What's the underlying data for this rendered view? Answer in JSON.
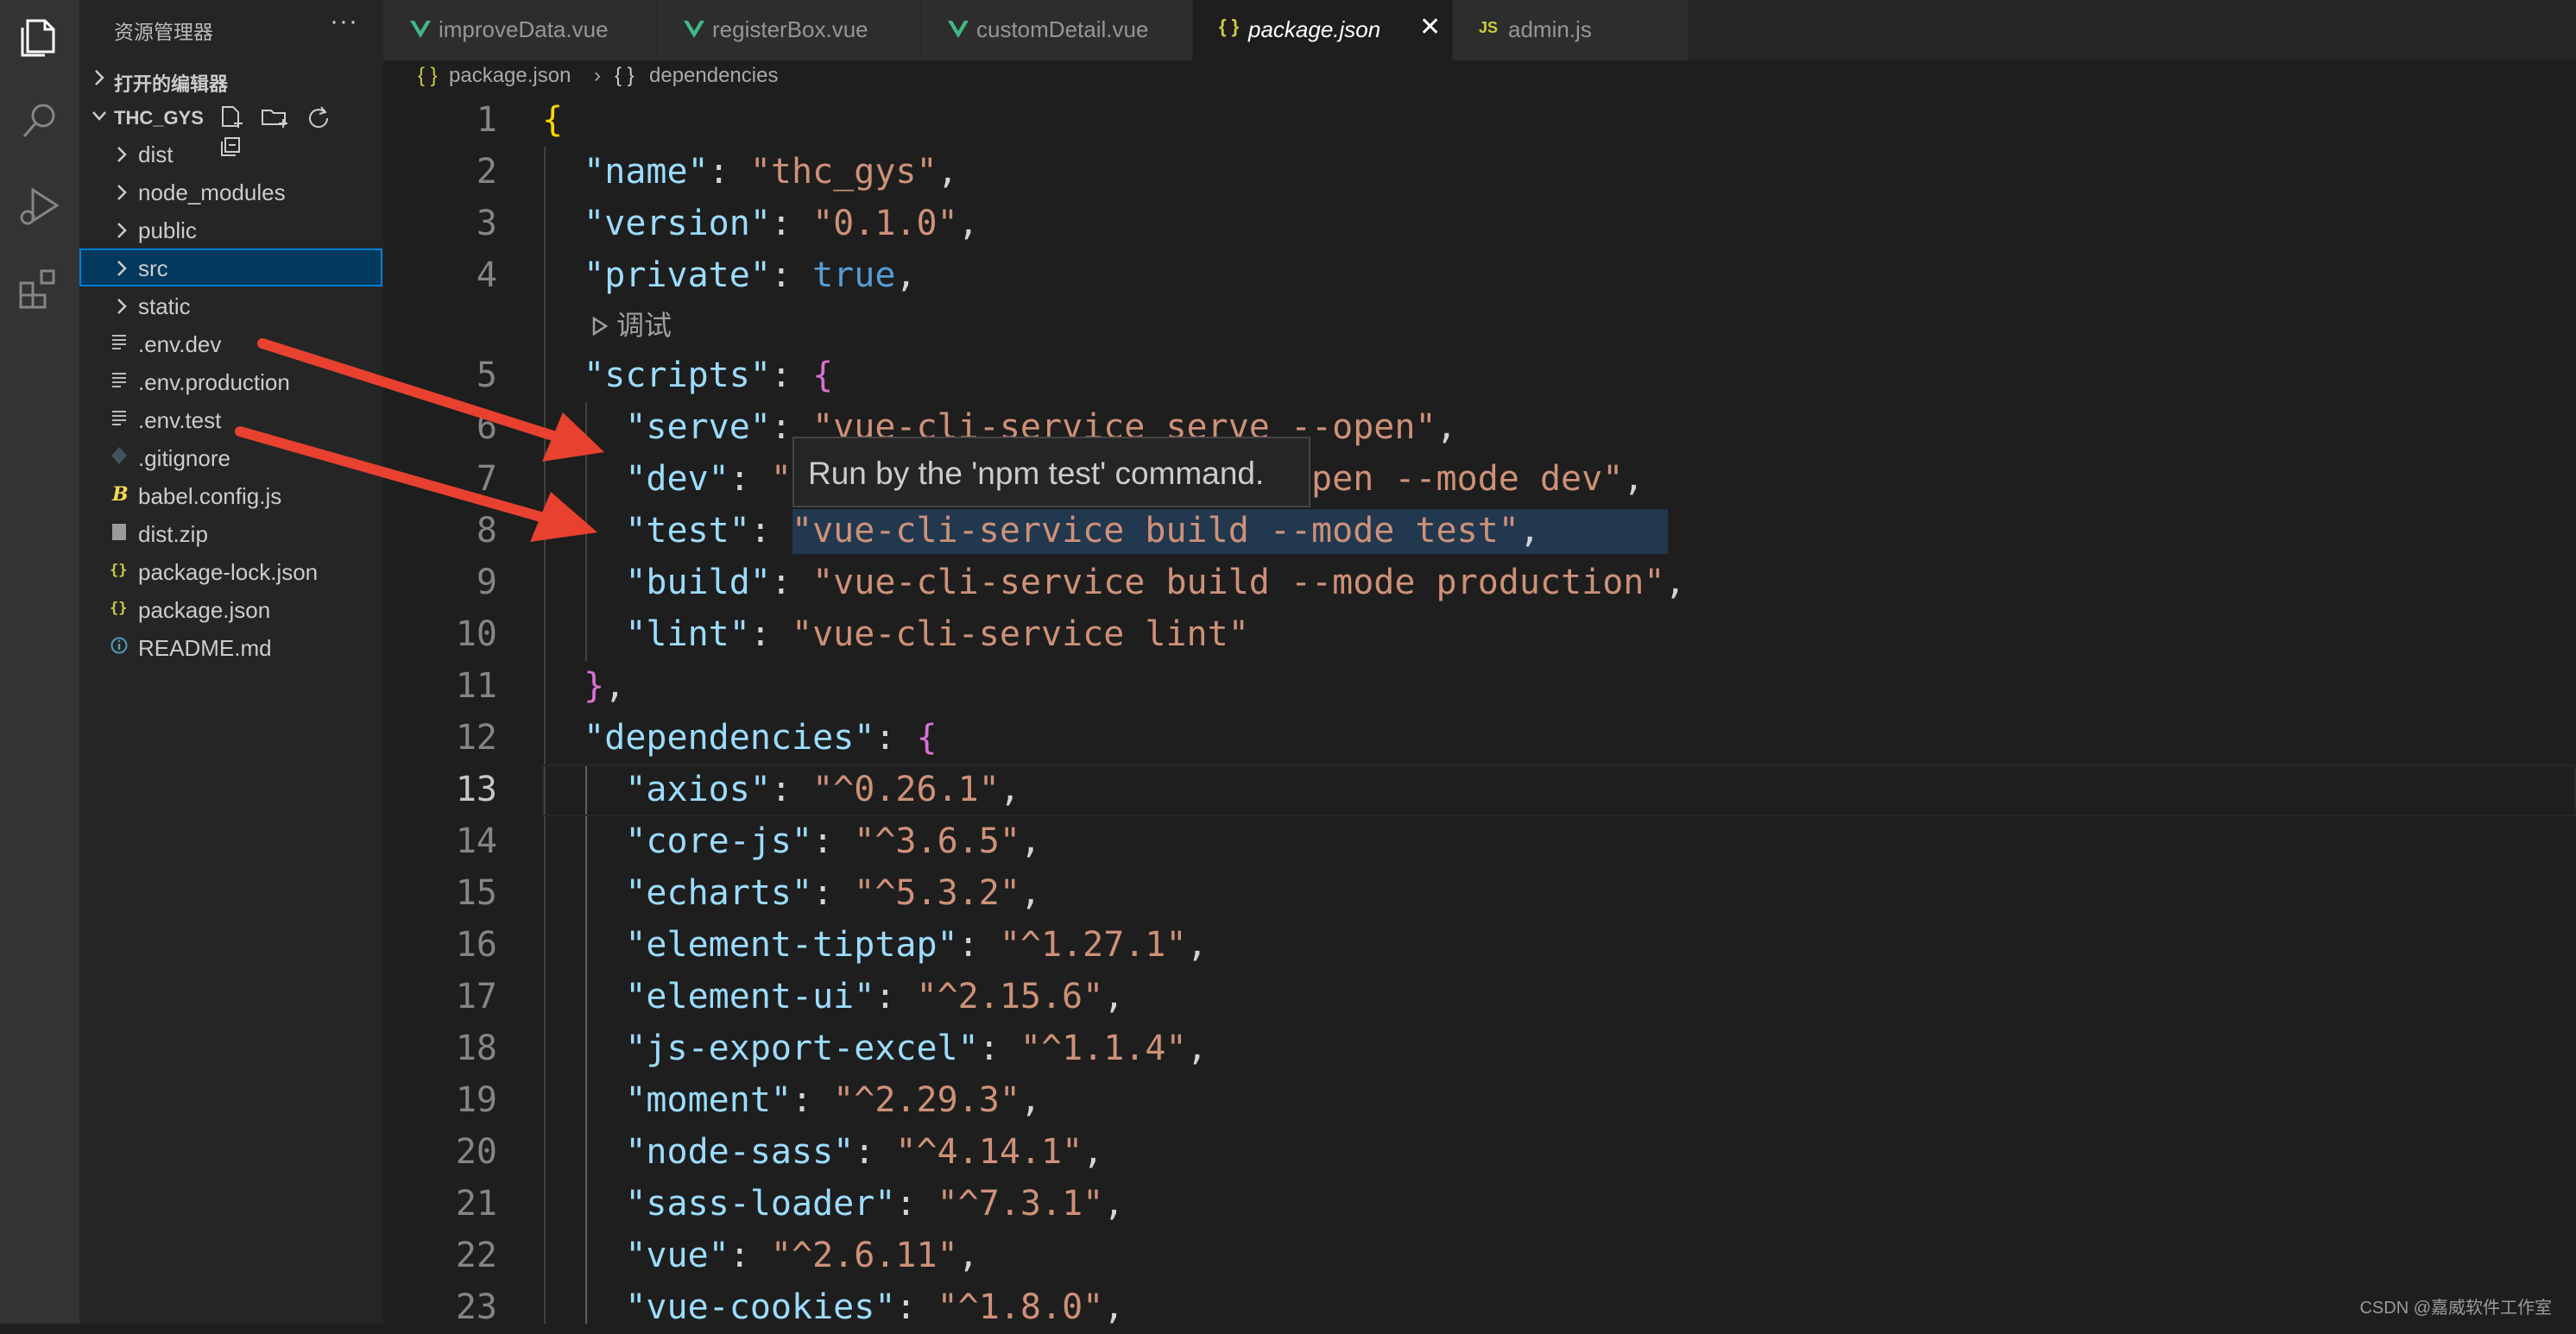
{
  "sidebar": {
    "title": "资源管理器",
    "more": "···",
    "sections": {
      "open_editors": "打开的编辑器",
      "workspace": "THC_GYS"
    },
    "tree": [
      {
        "label": "dist",
        "kind": "folder"
      },
      {
        "label": "node_modules",
        "kind": "folder"
      },
      {
        "label": "public",
        "kind": "folder"
      },
      {
        "label": "src",
        "kind": "folder",
        "selected": true
      },
      {
        "label": "static",
        "kind": "folder"
      },
      {
        "label": ".env.dev",
        "kind": "file-lines"
      },
      {
        "label": ".env.production",
        "kind": "file-lines"
      },
      {
        "label": ".env.test",
        "kind": "file-lines"
      },
      {
        "label": ".gitignore",
        "kind": "git"
      },
      {
        "label": "babel.config.js",
        "kind": "babel"
      },
      {
        "label": "dist.zip",
        "kind": "zip"
      },
      {
        "label": "package-lock.json",
        "kind": "json"
      },
      {
        "label": "package.json",
        "kind": "json"
      },
      {
        "label": "README.md",
        "kind": "info"
      }
    ]
  },
  "tabs": [
    {
      "label": "improveData.vue",
      "icon": "vue-icon"
    },
    {
      "label": "registerBox.vue",
      "icon": "vue-icon"
    },
    {
      "label": "customDetail.vue",
      "icon": "vue-icon"
    },
    {
      "label": "package.json",
      "icon": "json-icon",
      "active": true,
      "close": "✕"
    },
    {
      "label": "admin.js",
      "icon": "js-icon"
    }
  ],
  "tab_icons": {
    "json": "{ }",
    "js": "JS"
  },
  "breadcrumb": {
    "file": "package.json",
    "separator": "›",
    "symbol": "dependencies",
    "icon_text": "{ }"
  },
  "editor": {
    "codelens": "调试",
    "lines": [
      {
        "n": "1"
      },
      {
        "n": "2"
      },
      {
        "n": "3"
      },
      {
        "n": "4"
      },
      {
        "n": "5"
      },
      {
        "n": "6"
      },
      {
        "n": "7"
      },
      {
        "n": "8"
      },
      {
        "n": "9"
      },
      {
        "n": "10"
      },
      {
        "n": "11"
      },
      {
        "n": "12"
      },
      {
        "n": "13"
      },
      {
        "n": "14"
      },
      {
        "n": "15"
      },
      {
        "n": "16"
      },
      {
        "n": "17"
      },
      {
        "n": "18"
      },
      {
        "n": "19"
      },
      {
        "n": "20"
      },
      {
        "n": "21"
      },
      {
        "n": "22"
      },
      {
        "n": "23"
      }
    ],
    "json": {
      "name": "thc_gys",
      "version": "0.1.0",
      "private": "true",
      "scripts": {
        "serve": "vue-cli-service serve --open",
        "dev": "vue-cli-service serve --open --mode dev",
        "test": "vue-cli-service build --mode test",
        "build": "vue-cli-service build --mode production",
        "lint": "vue-cli-service lint"
      },
      "dependencies": {
        "axios": "^0.26.1",
        "core-js": "^3.6.5",
        "echarts": "^5.3.2",
        "element-tiptap": "^1.27.1",
        "element-ui": "^2.15.6",
        "js-export-excel": "^1.1.4",
        "moment": "^2.29.3",
        "node-sass": "^4.14.1",
        "sass-loader": "^7.3.1",
        "vue": "^2.6.11",
        "vue-cookies": "^1.8.0"
      }
    }
  },
  "tooltip": "Run by the 'npm test' command.",
  "watermark": "CSDN @嘉威软件工作室",
  "colors": {
    "arrow": "#e8412f",
    "selection": "#04395e",
    "key": "#9cdcfe",
    "string": "#ce9178"
  }
}
